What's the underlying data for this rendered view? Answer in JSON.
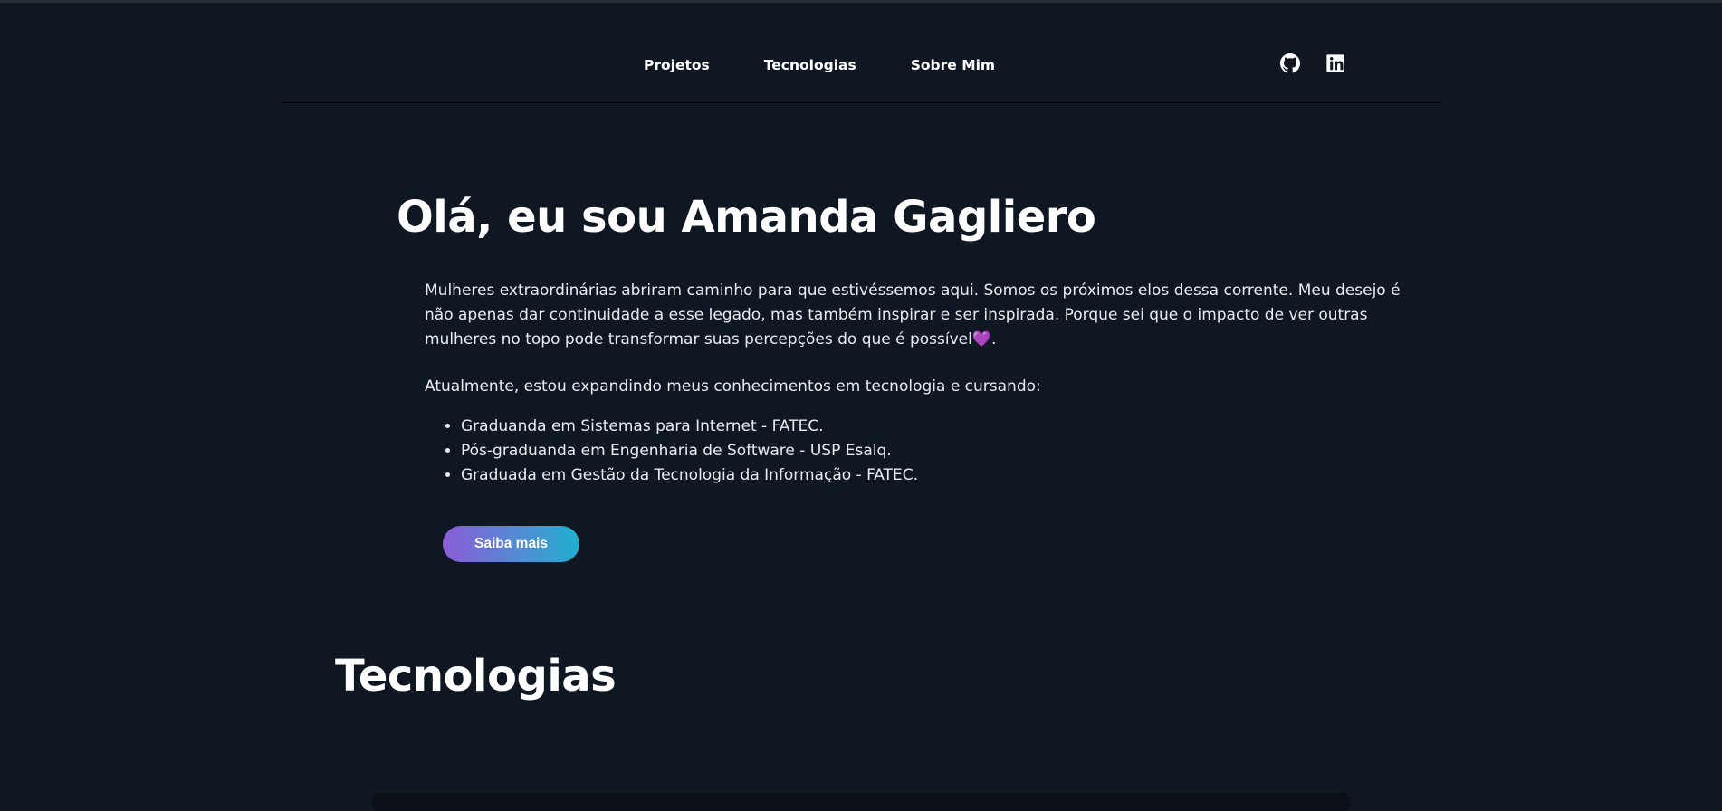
{
  "nav": {
    "links": [
      "Projetos",
      "Tecnologias",
      "Sobre Mim"
    ],
    "icons": [
      "github-icon",
      "linkedin-icon"
    ]
  },
  "hero": {
    "title": "Olá, eu sou Amanda Gagliero",
    "intro": "Mulheres extraordinárias abriram caminho para que estivéssemos aqui. Somos os próximos elos dessa corrente. Meu desejo é não apenas dar continuidade a esse legado, mas também inspirar e ser inspirada. Porque sei que o impacto de ver outras mulheres no topo pode transformar suas percepções do que é possível",
    "heart": "💜",
    "intro_end": ".",
    "current": "Atualmente, estou expandindo meus conhecimentos em tecnologia e cursando:",
    "courses": [
      "Graduanda em Sistemas para Internet - FATEC.",
      "Pós-graduanda em Engenharia de Software - USP Esalq.",
      "Graduada em Gestão da Tecnologia da Informação - FATEC."
    ],
    "cta_label": "Saiba mais"
  },
  "technologies": {
    "title": "Tecnologias"
  },
  "colors": {
    "background": "#0f1723",
    "accent_start": "#8b5cd6",
    "accent_end": "#1fb0cf",
    "heart": "#8b6cf0"
  }
}
